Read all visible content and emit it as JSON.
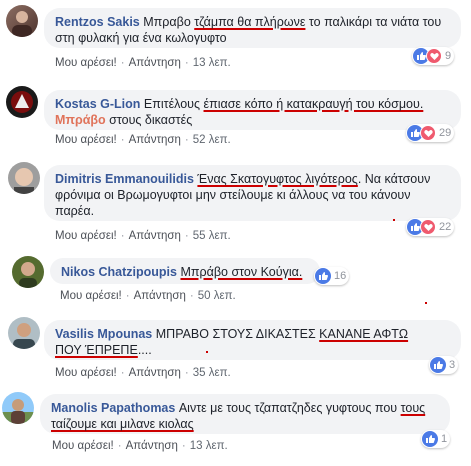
{
  "comments": [
    {
      "author": "Rentzos Sakis",
      "text_before": "Μπραβο ",
      "text_marked": "τζάμπα θα πλήρωνε",
      "text_after": " το παλικάρι τα νιάτα του στη φυλακή για ένα κωλογυφτο",
      "like": "Μου αρέσει!",
      "reply": "Απάντηση",
      "time": "13 λεπ.",
      "reactions": "9"
    },
    {
      "author": "Kostas G-Lion",
      "text_before": "Επιτέλους ",
      "text_marked": "έπιασε κόπο ή κατακραυγή του κόσμου.",
      "text_highlight": "Μπράβο",
      "text_after": " στους δικαστές",
      "like": "Μου αρέσει!",
      "reply": "Απάντηση",
      "time": "52 λεπ.",
      "reactions": "29"
    },
    {
      "author": "Dimitris Emmanouilidis",
      "text_marked": "Ένας Σκατογυφτος λιγότερος",
      "text_after": ". Να κάτσουν φρόνιμα οι Βρωμογυφτοι μην στείλουμε κι άλλους να του κάνουν παρέα.",
      "like": "Μου αρέσει!",
      "reply": "Απάντηση",
      "time": "55 λεπ.",
      "reactions": "22"
    },
    {
      "author": "Nikos Chatzipoupis",
      "text_marked": "Μπράβο στον Κούγια.",
      "like": "Μου αρέσει!",
      "reply": "Απάντηση",
      "time": "50 λεπ.",
      "reactions": "16"
    },
    {
      "author": "Vasilis Mpounas",
      "text_before": "ΜΠΡΑΒΟ ΣΤΟΥΣ ΔΙΚΑΣΤΕΣ ",
      "text_marked": "ΚΑΝΑΝΕ ΑΦΤΩ",
      "text_marked2": "ΠΟΥ ΈΠΡΕΠΕ",
      "text_after": "....",
      "like": "Μου αρέσει!",
      "reply": "Απάντηση",
      "time": "35 λεπ.",
      "reactions": "3"
    },
    {
      "author": "Manolis Papathomas",
      "text_before": "Αιντε με τους τζαπατζηδες γυφτους που ",
      "text_marked": "τους",
      "text_marked2": "ταίζουμε και μιλανε κιολας",
      "like": "Μου αρέσει!",
      "reply": "Απάντηση",
      "time": "13 λεπ.",
      "reactions": "1"
    }
  ],
  "colors": {
    "name": "#385898",
    "bubble": "#f2f3f5",
    "underline": "#cc0000",
    "like": "#4b7ae6",
    "love": "#ef5a6e"
  }
}
